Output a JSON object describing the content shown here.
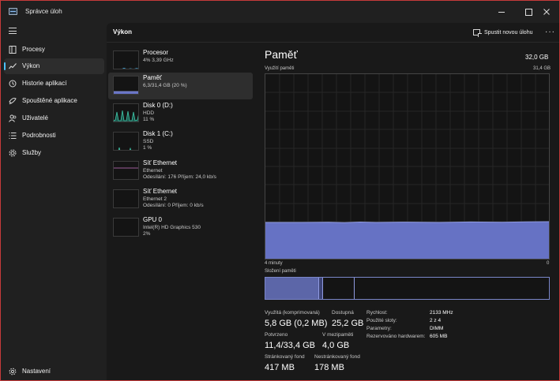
{
  "app": {
    "title": "Správce úloh"
  },
  "colors": {
    "accent": "#4cc2ff",
    "memory": "#7480d0",
    "memory_fill": "#6672c4",
    "disk": "#3ec6a8",
    "network": "#c875c4",
    "border": "#c63a3a"
  },
  "sidebar": {
    "items": [
      {
        "label": "Procesy",
        "icon": "processes-icon"
      },
      {
        "label": "Výkon",
        "icon": "performance-icon",
        "active": true
      },
      {
        "label": "Historie aplikací",
        "icon": "history-icon"
      },
      {
        "label": "Spouštěné aplikace",
        "icon": "startup-icon"
      },
      {
        "label": "Uživatelé",
        "icon": "users-icon"
      },
      {
        "label": "Podrobnosti",
        "icon": "details-icon"
      },
      {
        "label": "Služby",
        "icon": "services-icon"
      }
    ],
    "settings_label": "Nastavení"
  },
  "header": {
    "title": "Výkon",
    "run_task_label": "Spustit novou úlohu",
    "more_label": "···"
  },
  "perf_list": [
    {
      "name": "Procesor",
      "sub1": "4% 3,39 GHz",
      "sub2": ""
    },
    {
      "name": "Paměť",
      "sub1": "6,3/31,4 GB (20 %)",
      "sub2": ""
    },
    {
      "name": "Disk 0 (D:)",
      "sub1": "HDD",
      "sub2": "11 %"
    },
    {
      "name": "Disk 1 (C:)",
      "sub1": "SSD",
      "sub2": "1 %"
    },
    {
      "name": "Síť Ethernet",
      "sub1": "Ethernet",
      "sub2": "Odesílání: 176 Příjem: 24,0 kb/s"
    },
    {
      "name": "Síť Ethernet",
      "sub1": "Ethernet 2",
      "sub2": "Odesílání: 0 Příjem: 0 kb/s"
    },
    {
      "name": "GPU 0",
      "sub1": "Intel(R) HD Graphics 530",
      "sub2": "2%"
    }
  ],
  "detail": {
    "title": "Paměť",
    "total": "32,0 GB",
    "usage_label": "Využití paměti",
    "usage_max": "31,4 GB",
    "time_left": "4 minuty",
    "time_right": "0",
    "composition_label": "Složení paměti",
    "usage_fraction": 0.2,
    "stats": {
      "in_use_label": "Využitá (komprimovaná)",
      "in_use_value": "5,8 GB (0,2 MB)",
      "available_label": "Dostupná",
      "available_value": "25,2 GB",
      "committed_label": "Potvrzeno",
      "committed_value": "11,4/33,4 GB",
      "cached_label": "V mezipaměti",
      "cached_value": "4,0 GB",
      "paged_label": "Stránkovaný fond",
      "paged_value": "417 MB",
      "nonpaged_label": "Nestránkovaný fond",
      "nonpaged_value": "178 MB"
    },
    "props": [
      {
        "key": "Rychlost:",
        "value": "2133 MHz"
      },
      {
        "key": "Použité sloty:",
        "value": "2 z 4"
      },
      {
        "key": "Parametry:",
        "value": "DIMM"
      },
      {
        "key": "Rezervováno hardwarem:",
        "value": "605 MB"
      }
    ]
  }
}
